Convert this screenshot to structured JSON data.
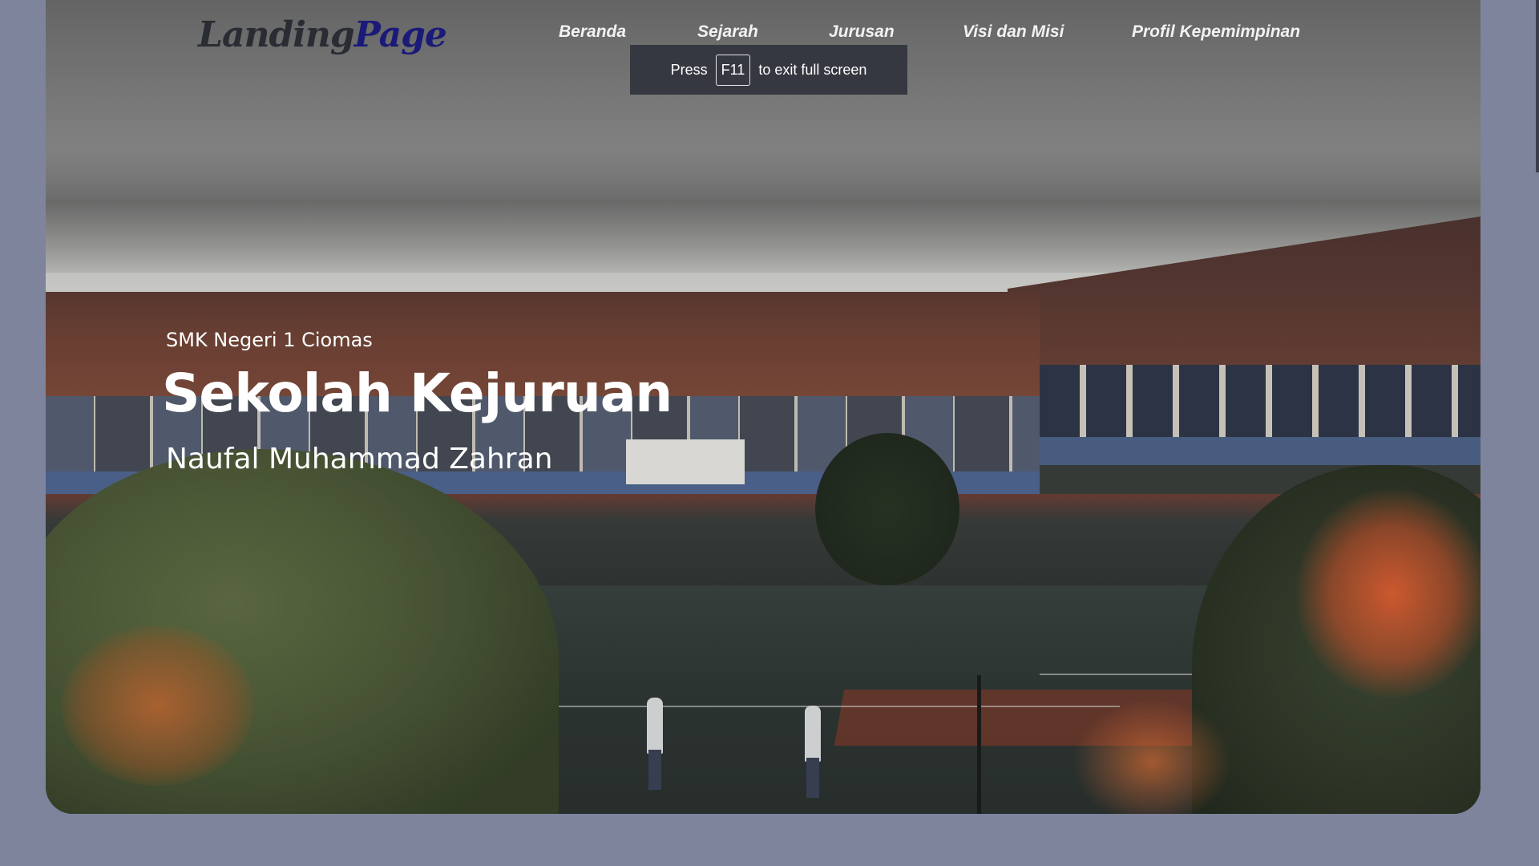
{
  "logo": {
    "part1": "Landing",
    "part2": "Page"
  },
  "nav": {
    "items": [
      {
        "label": "Beranda"
      },
      {
        "label": "Sejarah"
      },
      {
        "label": "Jurusan"
      },
      {
        "label": "Visi dan Misi"
      },
      {
        "label": "Profil Kepemimpinan"
      }
    ]
  },
  "fullscreen_notice": {
    "prefix": "Press",
    "key": "F11",
    "suffix": "to exit full screen"
  },
  "hero": {
    "subtitle": "SMK Negeri 1 Ciomas",
    "title": "Sekolah Kejuruan",
    "name": "Naufal Muhammad Zahran"
  },
  "colors": {
    "page_background": "#7e849c",
    "logo_dark": "#2a2c33",
    "logo_accent": "#1b1a78",
    "nav_text": "#f2f2f2",
    "toast_background": "#363841"
  }
}
